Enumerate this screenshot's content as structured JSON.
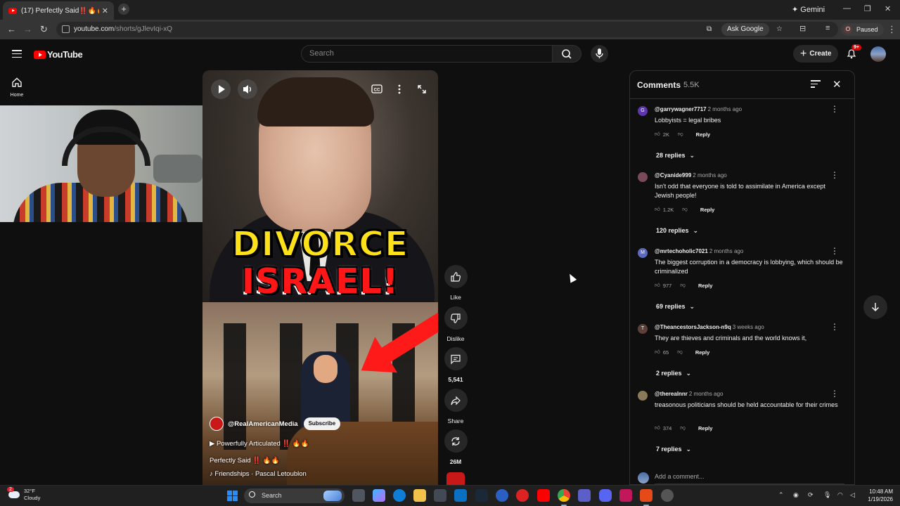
{
  "browser": {
    "tab_title": "(17) Perfectly Said‼️🔥🔥 - You",
    "tab_close": "✕",
    "new_tab": "+",
    "gemini": "✦ Gemini",
    "url_host": "youtube.com",
    "url_path": "/shorts/gJlevIqi-xQ",
    "ask_google": "Ask Google",
    "profile_initial": "O",
    "profile_status": "Paused"
  },
  "youtube": {
    "logo_text": "YouTube",
    "search_placeholder": "Search",
    "create_label": "Create",
    "notifications_badge": "9+",
    "home_label": "Home"
  },
  "short": {
    "headline_line1": "DIVORCE",
    "headline_line2": "ISRAEL!",
    "channel": "@RealAmericanMedia",
    "subscribe": "Subscribe",
    "playlist": "Powerfully Articulated ‼️ 🔥🔥",
    "title": "Perfectly Said ‼️ 🔥🔥",
    "music": "Friendships · Pascal Letoublon"
  },
  "actions": {
    "like": "Like",
    "dislike": "Dislike",
    "comments": "5,541",
    "share": "Share",
    "remix": "26M"
  },
  "comments_panel": {
    "title": "Comments",
    "count": "5.5K",
    "add_placeholder": "Add a comment...",
    "reply_label": "Reply",
    "items": [
      {
        "initial": "G",
        "avatar_color": "#5e35b1",
        "user": "@garrywagner7717",
        "ago": "2 months ago",
        "text": "Lobbyists = legal bribes",
        "likes": "2K",
        "replies": "28 replies"
      },
      {
        "initial": "",
        "avatar_color": "#7a4a5a",
        "user": "@Cyanide999",
        "ago": "2 months ago",
        "text": "Isn't odd that everyone is told to assimilate in America except Jewish people!",
        "likes": "1.2K",
        "replies": "120 replies"
      },
      {
        "initial": "M",
        "avatar_color": "#5c6bc0",
        "user": "@mrtechoholic7021",
        "ago": "2 months ago",
        "text": "The biggest corruption in a democracy is lobbying, which should be criminalized",
        "likes": "977",
        "replies": "69 replies"
      },
      {
        "initial": "T",
        "avatar_color": "#5d4037",
        "user": "@TheancestorsJackson-n9q",
        "ago": "3 weeks ago",
        "text": "They are thieves and criminals and the world knows it,",
        "likes": "65",
        "replies": "2 replies"
      },
      {
        "initial": "",
        "avatar_color": "#8a7a5a",
        "user": "@therealnnr",
        "ago": "2 months ago",
        "text": "treasonous politicians should be held accountable for their crimes",
        "likes": "374",
        "replies": "7 replies"
      }
    ]
  },
  "taskbar": {
    "temp": "32°F",
    "condition": "Cloudy",
    "weather_badge": "2",
    "search": "Search",
    "time": "10:48 AM",
    "date": "1/19/2026"
  }
}
